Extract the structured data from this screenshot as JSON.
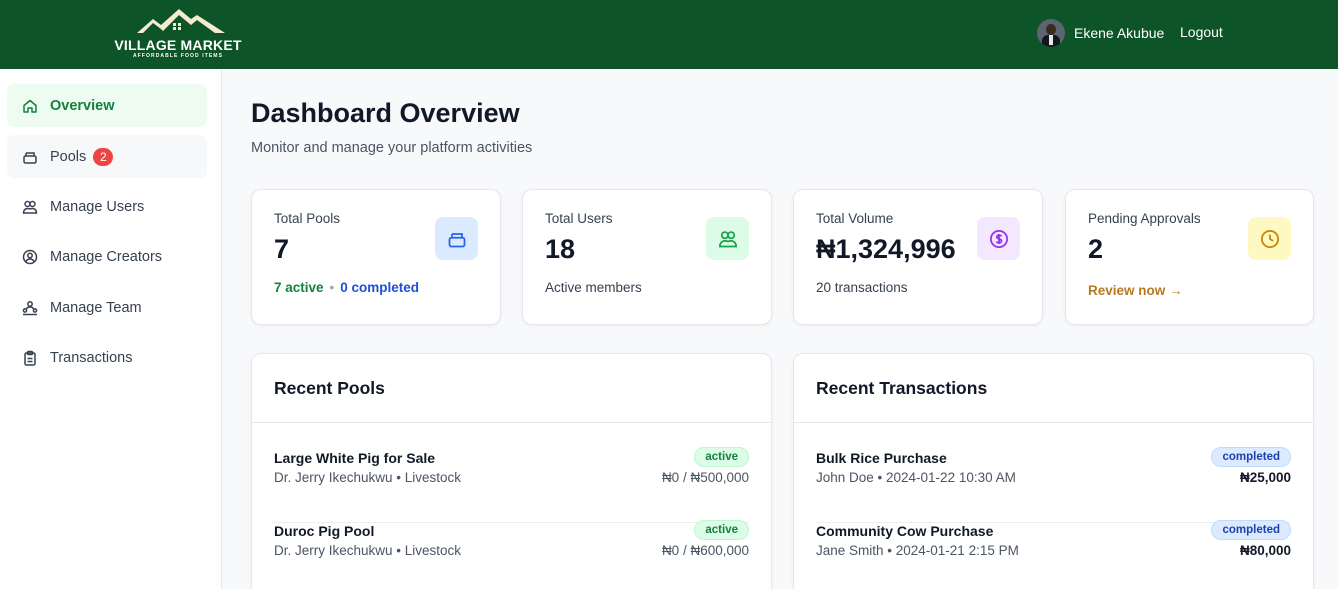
{
  "header": {
    "logo_title": "VILLAGE MARKET",
    "logo_subtitle": "AFFORDABLE FOOD ITEMS",
    "user_name": "Ekene Akubue",
    "logout_label": "Logout"
  },
  "sidebar": {
    "items": [
      {
        "label": "Overview",
        "icon": "home-icon"
      },
      {
        "label": "Pools",
        "icon": "pool-icon",
        "badge": "2"
      },
      {
        "label": "Manage Users",
        "icon": "users-icon"
      },
      {
        "label": "Manage Creators",
        "icon": "user-circle-icon"
      },
      {
        "label": "Manage Team",
        "icon": "team-icon"
      },
      {
        "label": "Transactions",
        "icon": "clipboard-icon"
      }
    ]
  },
  "main": {
    "title": "Dashboard Overview",
    "subtitle": "Monitor and manage your platform activities",
    "stats": [
      {
        "label": "Total Pools",
        "value": "7",
        "active": "7 active",
        "sep": "•",
        "completed": "0 completed",
        "icon": "pool-icon",
        "accent": "#2563eb"
      },
      {
        "label": "Total Users",
        "value": "18",
        "foot": "Active members",
        "icon": "users-icon",
        "accent": "#16a34a"
      },
      {
        "label": "Total Volume",
        "value": "₦1,324,996",
        "foot": "20 transactions",
        "icon": "dollar-icon",
        "accent": "#9333ea"
      },
      {
        "label": "Pending Approvals",
        "value": "2",
        "foot": "Review now →",
        "icon": "clock-icon",
        "accent": "#ca8a04"
      }
    ],
    "recent_pools": {
      "title": "Recent Pools",
      "rows": [
        {
          "title": "Large White Pig for Sale",
          "meta": "Dr. Jerry Ikechukwu • Livestock",
          "status": "active",
          "amount": "₦0 / ₦500,000"
        },
        {
          "title": "Duroc Pig Pool",
          "meta": "Dr. Jerry Ikechukwu • Livestock",
          "status": "active",
          "amount": "₦0 / ₦600,000"
        }
      ]
    },
    "recent_transactions": {
      "title": "Recent Transactions",
      "rows": [
        {
          "title": "Bulk Rice Purchase",
          "meta": "John Doe • 2024-01-22 10:30 AM",
          "status": "completed",
          "amount": "₦25,000"
        },
        {
          "title": "Community Cow Purchase",
          "meta": "Jane Smith • 2024-01-21 2:15 PM",
          "status": "completed",
          "amount": "₦80,000"
        }
      ]
    }
  }
}
